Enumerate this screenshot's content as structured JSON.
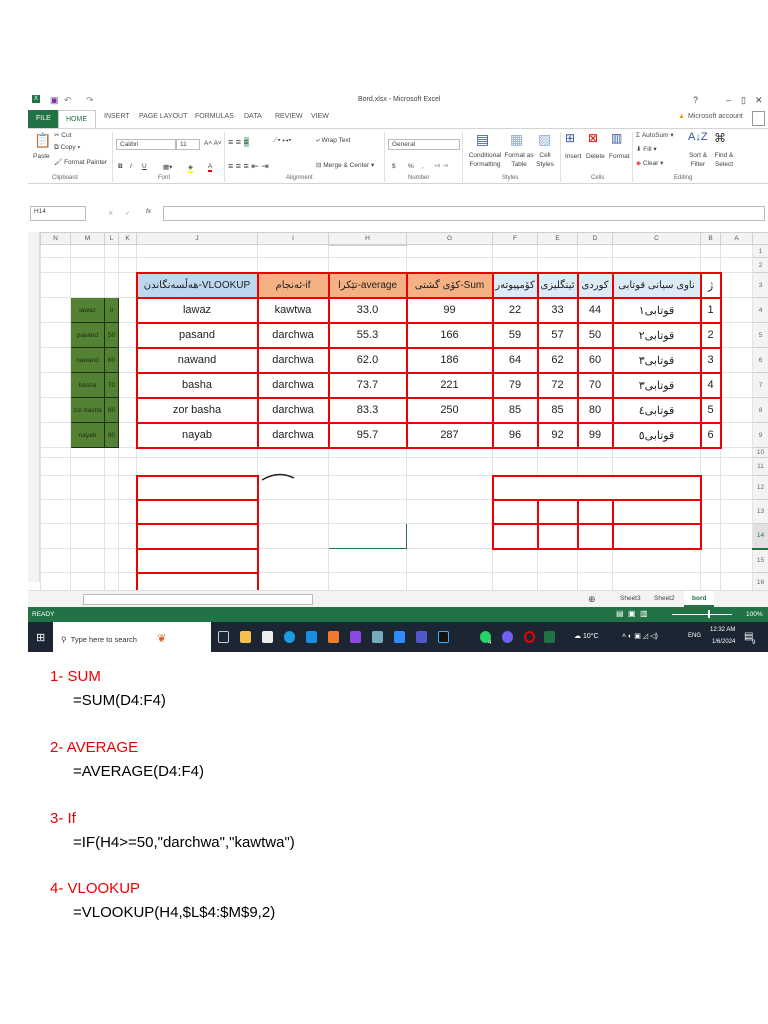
{
  "window": {
    "title": "Bord.xlsx - Microsoft Excel",
    "help": "?",
    "minimize": "–",
    "restore": "▯",
    "close": "✕",
    "account": "Microsoft account"
  },
  "tabs": [
    "FILE",
    "HOME",
    "INSERT",
    "PAGE LAYOUT",
    "FORMULAS",
    "DATA",
    "REVIEW",
    "VIEW"
  ],
  "ribbon": {
    "clipboard": {
      "paste": "Paste",
      "cut": "Cut",
      "copy": "Copy",
      "format_painter": "Format Painter",
      "label": "Clipboard"
    },
    "font": {
      "name": "Calibri",
      "size": "11",
      "bold": "B",
      "italic": "I",
      "underline": "U",
      "label": "Font"
    },
    "alignment": {
      "wrap": "Wrap Text",
      "merge": "Merge & Center",
      "label": "Alignment"
    },
    "number": {
      "format": "General",
      "currency": "$",
      "percent": "%",
      "comma": ",",
      "label": "Number"
    },
    "styles": {
      "conditional": "Conditional Formatting",
      "format_table": "Format as Table",
      "cell_styles": "Cell Styles",
      "label": "Styles"
    },
    "cells": {
      "insert": "Insert",
      "delete": "Delete",
      "format": "Format",
      "label": "Cells"
    },
    "editing": {
      "autosum": "AutoSum",
      "fill": "Fill",
      "clear": "Clear",
      "sort": "Sort & Filter",
      "find": "Find & Select",
      "label": "Editing"
    }
  },
  "formula_bar": {
    "name_box": "H14",
    "fx": "fx",
    "value": ""
  },
  "columns": [
    "N",
    "M",
    "L",
    "K",
    "J",
    "I",
    "H",
    "G",
    "F",
    "E",
    "D",
    "C",
    "B",
    "A"
  ],
  "rows": [
    "1",
    "2",
    "3",
    "4",
    "5",
    "6",
    "7",
    "8",
    "9",
    "10",
    "11",
    "12",
    "13",
    "14",
    "15",
    "16"
  ],
  "cells": {
    "J3": "هەڵسەنگاندن-VLOOKUP",
    "I3": "ئەنجام-if",
    "H3": "تێکرا-average",
    "G3": "کۆی گشتی-Sum",
    "F3": "کۆمپیوتەر",
    "E3": "ئینگلیزی",
    "D3": "کوردی",
    "C3": "ناوی سیانی قوتابی",
    "B3": "ژ",
    "J4": "lawaz",
    "I4": "kawtwa",
    "H4": "33.0",
    "G4": "99",
    "F4": "22",
    "E4": "33",
    "D4": "44",
    "C4": "قوتابی١",
    "B4": "1",
    "J5": "pasand",
    "I5": "darchwa",
    "H5": "55.3",
    "G5": "166",
    "F5": "59",
    "E5": "57",
    "D5": "50",
    "C5": "قوتابی٢",
    "B5": "2",
    "J6": "nawand",
    "I6": "darchwa",
    "H6": "62.0",
    "G6": "186",
    "F6": "64",
    "E6": "62",
    "D6": "60",
    "C6": "قوتابی٣",
    "B6": "3",
    "J7": "basha",
    "I7": "darchwa",
    "H7": "73.7",
    "G7": "221",
    "F7": "79",
    "E7": "72",
    "D7": "70",
    "C7": "قوتابی٣",
    "B7": "4",
    "J8": "zor basha",
    "I8": "darchwa",
    "H8": "83.3",
    "G8": "250",
    "F8": "85",
    "E8": "85",
    "D8": "80",
    "C8": "قوتابی٤",
    "B8": "5",
    "J9": "nayab",
    "I9": "darchwa",
    "H9": "95.7",
    "G9": "287",
    "F9": "96",
    "E9": "92",
    "D9": "99",
    "C9": "قوتابی٥",
    "B9": "6",
    "M4": "lawaz",
    "L4": "0",
    "M5": "pasand",
    "L5": "50",
    "M6": "nawand",
    "L6": "60",
    "M7": "basha",
    "L7": "70",
    "M8": "zor basha",
    "L8": "80",
    "M9": "nayab",
    "L9": "90"
  },
  "sheet_tabs": [
    "Sheet3",
    "Sheet2",
    "bord"
  ],
  "active_sheet": "bord",
  "status": {
    "ready": "READY",
    "zoom": "100%"
  },
  "taskbar": {
    "search_placeholder": "Type here to search",
    "weather": "10°C",
    "lang": "ENG",
    "time": "12:32 AM",
    "date": "1/6/2024",
    "whatsapp_badge": "4",
    "notif_badge": "9"
  },
  "doc": [
    {
      "title": "1-  SUM",
      "formula": "=SUM(D4:F4)"
    },
    {
      "title": "2-  AVERAGE",
      "formula": "=AVERAGE(D4:F4)"
    },
    {
      "title": "3-  If",
      "formula": "=IF(H4>=50,\"darchwa\",\"kawtwa\")"
    },
    {
      "title": "4-  VLOOKUP",
      "formula": "=VLOOKUP(H4,$L$4:$M$9,2)"
    }
  ]
}
